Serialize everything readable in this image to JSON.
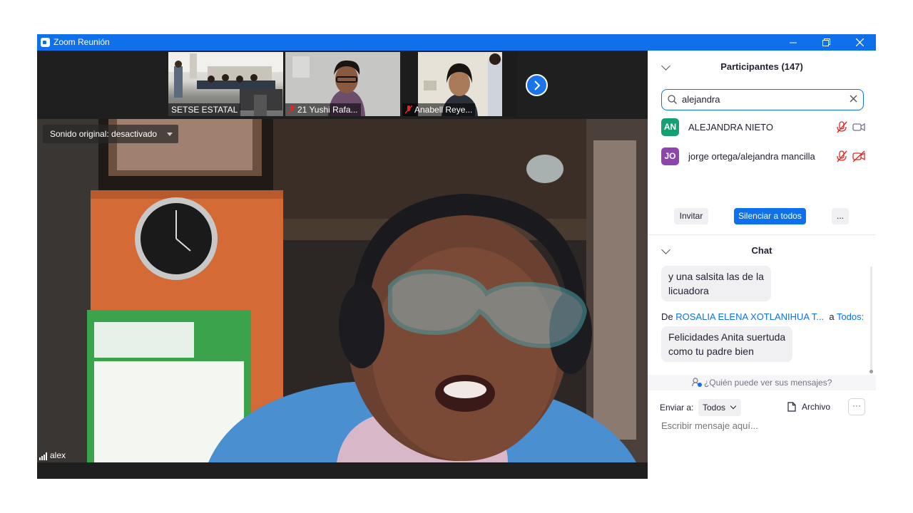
{
  "window": {
    "title": "Zoom Reunión"
  },
  "thumbnails": [
    {
      "name": "SETSE ESTATAL",
      "muted": false
    },
    {
      "name": "21 Yushi Rafa...",
      "muted": true
    },
    {
      "name": "Anabell Reye...",
      "muted": true
    }
  ],
  "main_video": {
    "sound_label": "Sonido original: desactivado",
    "speaker_name": "alex"
  },
  "participants": {
    "header": "Participantes (147)",
    "search_value": "alejandra",
    "list": [
      {
        "initials": "AN",
        "name": "ALEJANDRA NIETO",
        "color": "#14a072",
        "audio_muted": true,
        "video_off": false
      },
      {
        "initials": "JO",
        "name": "jorge ortega/alejandra mancilla",
        "color": "#8e44ad",
        "audio_muted": true,
        "video_off": true
      }
    ],
    "invite_label": "Invitar",
    "mute_all_label": "Silenciar a todos",
    "more_label": "..."
  },
  "chat": {
    "header": "Chat",
    "messages": [
      {
        "text_line1": "y una salsita las de la",
        "text_line2": "licuadora"
      },
      {
        "from_prefix": "De",
        "sender": "ROSALIA ELENA XOTLANIHUA T...",
        "to_prefix": "a",
        "recipient": "Todos:",
        "text_line1": "Felicidades Anita suertuda",
        "text_line2": "como tu padre bien"
      }
    ],
    "who_can_see": "¿Quién puede ver sus mensajes?",
    "send_to_label": "Enviar a:",
    "send_to_value": "Todos",
    "file_label": "Archivo",
    "more_label": "···",
    "input_placeholder": "Escribir mensaje aquí..."
  },
  "colors": {
    "accent": "#0e71eb",
    "titlebar": "#0e71eb",
    "mute_icon": "#e02828"
  }
}
